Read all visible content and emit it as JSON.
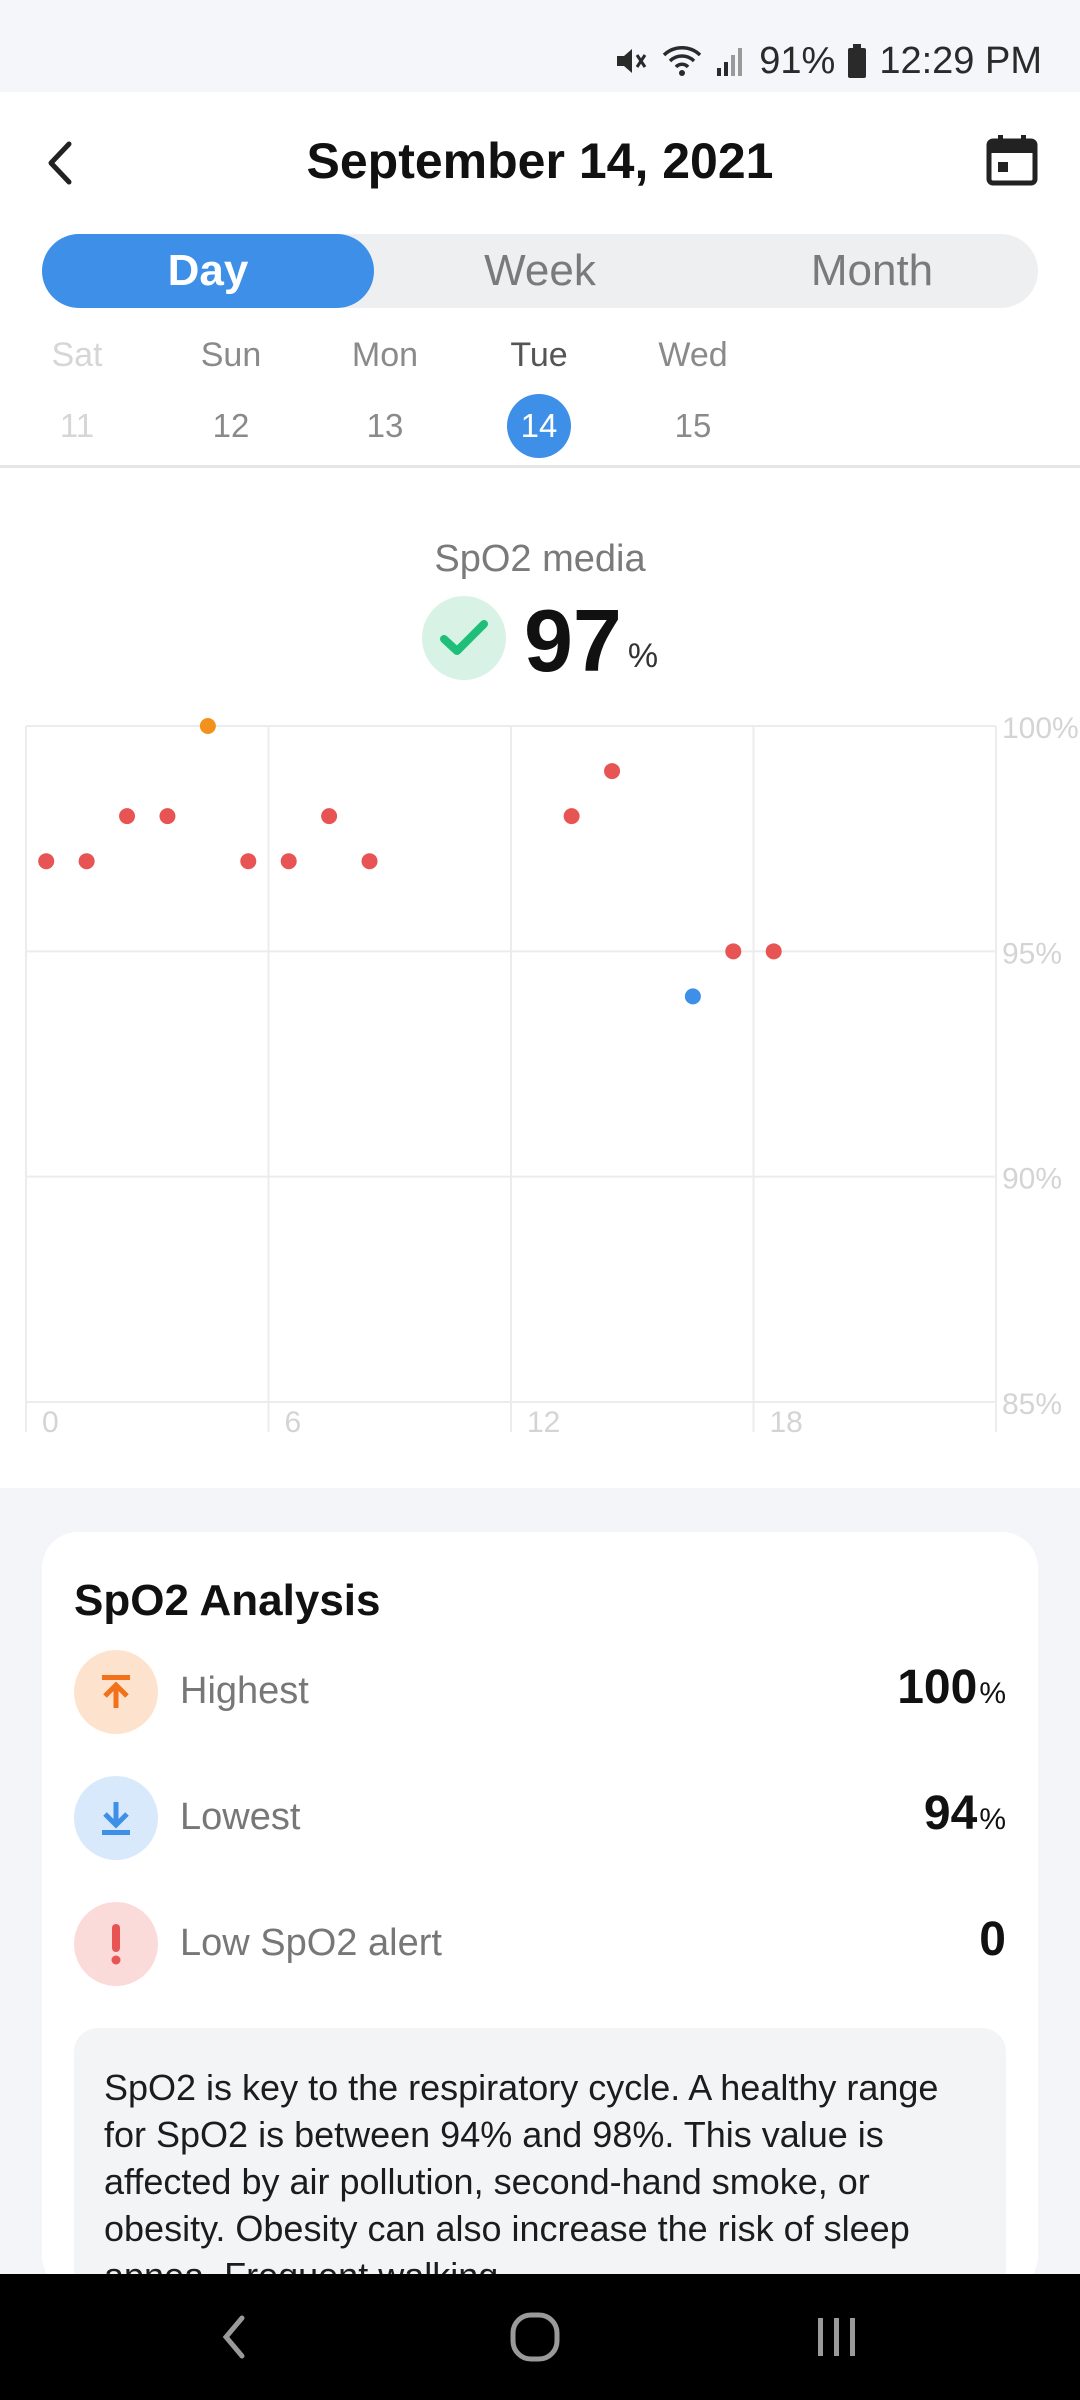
{
  "status": {
    "battery": "91%",
    "time": "12:29 PM"
  },
  "header": {
    "title": "September 14, 2021"
  },
  "tabs": [
    {
      "label": "Day",
      "active": true
    },
    {
      "label": "Week",
      "active": false
    },
    {
      "label": "Month",
      "active": false
    }
  ],
  "days": [
    {
      "name": "Sat",
      "num": "11",
      "state": "faded"
    },
    {
      "name": "Sun",
      "num": "12",
      "state": "normal"
    },
    {
      "name": "Mon",
      "num": "13",
      "state": "normal"
    },
    {
      "name": "Tue",
      "num": "14",
      "state": "selected"
    },
    {
      "name": "Wed",
      "num": "15",
      "state": "normal"
    }
  ],
  "summary": {
    "label": "SpO2 media",
    "value": "97",
    "unit": "%"
  },
  "chart_data": {
    "type": "scatter",
    "xlim": [
      0,
      24
    ],
    "ylim": [
      85,
      100
    ],
    "x_ticks": [
      "0",
      "6",
      "12",
      "18"
    ],
    "y_ticks": [
      "100%",
      "95%",
      "90%",
      "85%"
    ],
    "grid": true,
    "points": [
      {
        "x": 0.5,
        "y": 97,
        "kind": "normal"
      },
      {
        "x": 1.5,
        "y": 97,
        "kind": "normal"
      },
      {
        "x": 2.5,
        "y": 98,
        "kind": "normal"
      },
      {
        "x": 3.5,
        "y": 98,
        "kind": "normal"
      },
      {
        "x": 4.5,
        "y": 100,
        "kind": "highest"
      },
      {
        "x": 5.5,
        "y": 97,
        "kind": "normal"
      },
      {
        "x": 6.5,
        "y": 97,
        "kind": "normal"
      },
      {
        "x": 7.5,
        "y": 98,
        "kind": "normal"
      },
      {
        "x": 8.5,
        "y": 97,
        "kind": "normal"
      },
      {
        "x": 13.5,
        "y": 98,
        "kind": "normal"
      },
      {
        "x": 14.5,
        "y": 99,
        "kind": "normal"
      },
      {
        "x": 16.5,
        "y": 94,
        "kind": "lowest"
      },
      {
        "x": 17.5,
        "y": 95,
        "kind": "normal"
      },
      {
        "x": 18.5,
        "y": 95,
        "kind": "normal"
      }
    ],
    "colors": {
      "normal": "#e85454",
      "highest": "#f2921c",
      "lowest": "#3d8fe8"
    }
  },
  "analysis": {
    "title": "SpO2 Analysis",
    "highest": {
      "label": "Highest",
      "value": "100",
      "unit": "%"
    },
    "lowest": {
      "label": "Lowest",
      "value": "94",
      "unit": "%"
    },
    "alert": {
      "label": "Low SpO2 alert",
      "value": "0"
    },
    "info": "SpO2 is key to the respiratory cycle. A healthy range for SpO2 is between 94% and 98%. This value is affected by air pollution, second-hand smoke, or obesity. Obesity can also increase the risk of sleep apnea. Frequent walking"
  },
  "colors": {
    "accent": "#3d8fe8",
    "check": "#1fbf7a",
    "highest": "#f2721c",
    "lowest": "#3d8fe8",
    "alert": "#e85454"
  }
}
